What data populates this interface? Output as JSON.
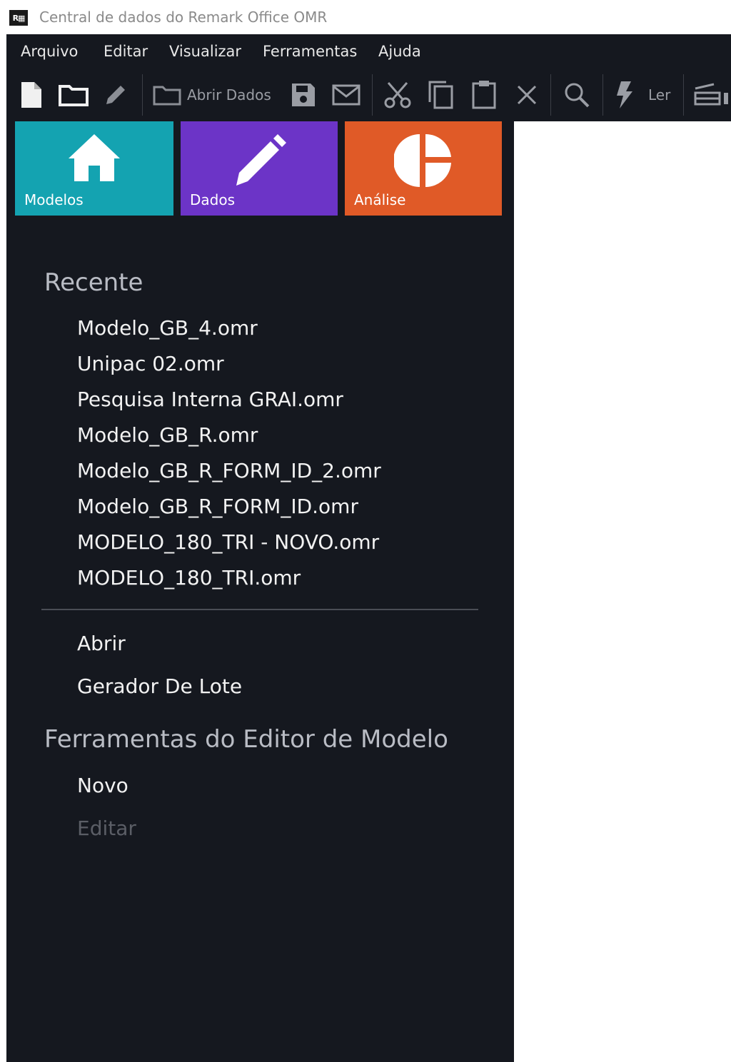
{
  "window": {
    "title": "Central de dados do Remark Office OMR",
    "app_icon_text": "R▦"
  },
  "menu": [
    "Arquivo",
    "Editar",
    "Visualizar",
    "Ferramentas",
    "Ajuda"
  ],
  "toolbar": {
    "open_data_label": "Abrir Dados",
    "read_label": "Ler"
  },
  "tiles": [
    {
      "label": "Modelos",
      "color": "#14a3b1",
      "icon": "home-icon"
    },
    {
      "label": "Dados",
      "color": "#6c34c7",
      "icon": "pencil-icon"
    },
    {
      "label": "Análise",
      "color": "#e05a27",
      "icon": "pie-chart-icon"
    }
  ],
  "recent": {
    "heading": "Recente",
    "files": [
      "Modelo_GB_4.omr",
      "Unipac 02.omr",
      "Pesquisa Interna GRAI.omr",
      "Modelo_GB_R.omr",
      "Modelo_GB_R_FORM_ID_2.omr",
      "Modelo_GB_R_FORM_ID.omr",
      "MODELO_180_TRI - NOVO.omr",
      "MODELO_180_TRI.omr"
    ]
  },
  "actions": {
    "open": "Abrir",
    "batch": "Gerador De Lote"
  },
  "editor_tools": {
    "heading": "Ferramentas do Editor de Modelo",
    "new": "Novo",
    "edit": "Editar"
  },
  "colors": {
    "panel_bg": "#15181f",
    "text": "#f2f2f2",
    "heading": "#b9bcc4"
  }
}
